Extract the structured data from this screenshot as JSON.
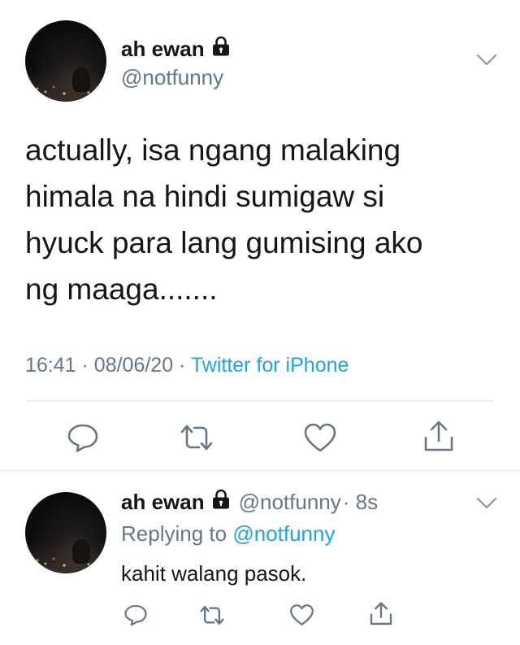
{
  "main_tweet": {
    "display_name": "ah ewan",
    "handle": "@notfunny",
    "text_lines": [
      "actually, isa ngang malaking",
      "himala na hindi sumigaw si",
      "hyuck para lang gumising ako",
      "ng maaga......."
    ],
    "time": "16:41",
    "separator": " · ",
    "date": "08/06/20",
    "source": "Twitter for iPhone",
    "icons": {
      "lock": "lock-icon",
      "more": "chevron-down-icon",
      "reply": "reply-icon",
      "retweet": "retweet-icon",
      "like": "heart-icon",
      "share": "share-icon"
    }
  },
  "reply_tweet": {
    "display_name": "ah ewan",
    "handle": "@notfunny",
    "time_ago": "· 8s",
    "replying_prefix": "Replying to ",
    "replying_to": "@notfunny",
    "text": "kahit walang pasok."
  },
  "colors": {
    "accent": "#1da1f2",
    "secondary_text": "#657786",
    "icon": "#657786",
    "divider": "#e1e8ed"
  }
}
